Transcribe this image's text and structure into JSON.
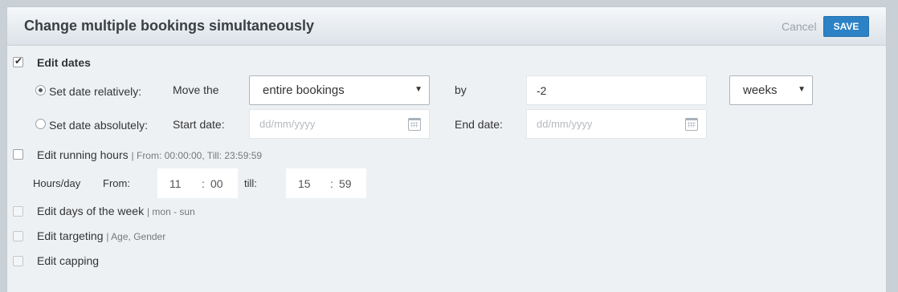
{
  "dialog": {
    "title": "Change multiple bookings simultaneously",
    "cancel_label": "Cancel",
    "save_label": "SAVE"
  },
  "edit_dates": {
    "label": "Edit dates",
    "checked": true,
    "relative": {
      "label": "Set date relatively:",
      "selected": true,
      "move_label": "Move the",
      "move_value": "entire bookings",
      "by_label": "by",
      "by_value": "-2",
      "unit_value": "weeks"
    },
    "absolute": {
      "label": "Set date absolutely:",
      "selected": false,
      "start_label": "Start date:",
      "start_placeholder": "dd/mm/yyyy",
      "end_label": "End date:",
      "end_placeholder": "dd/mm/yyyy"
    }
  },
  "running_hours": {
    "label": "Edit running hours",
    "summary": "| From: 00:00:00, Till: 23:59:59",
    "hours_day_label": "Hours/day",
    "from_label": "From:",
    "from_h": "11",
    "from_m": "00",
    "till_label": "till:",
    "till_h": "15",
    "till_m": "59",
    "colon": ":"
  },
  "days_of_week": {
    "label": "Edit days of the week",
    "summary": "| mon - sun"
  },
  "targeting": {
    "label": "Edit targeting",
    "summary": "| Age, Gender"
  },
  "capping": {
    "label": "Edit capping"
  }
}
